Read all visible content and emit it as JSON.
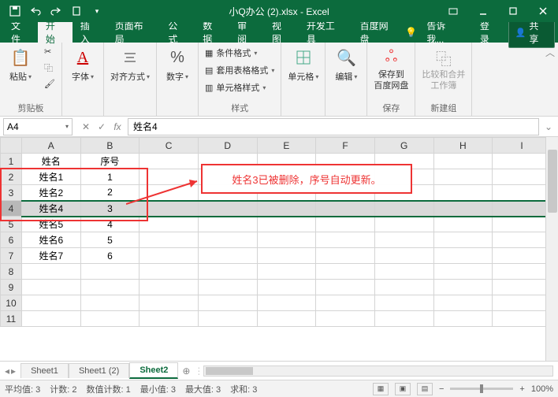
{
  "titlebar": {
    "title": "小Q办公 (2).xlsx - Excel"
  },
  "menu": {
    "file": "文件",
    "home": "开始",
    "insert": "插入",
    "layout": "页面布局",
    "formula": "公式",
    "data": "数据",
    "review": "审阅",
    "view": "视图",
    "dev": "开发工具",
    "baidu": "百度网盘",
    "tellme": "告诉我...",
    "login": "登录",
    "share": "共享"
  },
  "ribbon": {
    "paste": "粘贴",
    "clipboard": "剪贴板",
    "font": "字体",
    "align": "对齐方式",
    "number": "数字",
    "condfmt": "条件格式",
    "tablefmt": "套用表格格式",
    "cellfmt": "单元格样式",
    "styles": "样式",
    "cells": "单元格",
    "edit": "编辑",
    "baidu_save": "保存到",
    "baidu_line2": "百度网盘",
    "baidu_group": "保存",
    "compare": "比较和合并",
    "compare2": "工作簿",
    "newgroup": "新建组"
  },
  "fx": {
    "name": "A4",
    "formula": "姓名4"
  },
  "cols": [
    "A",
    "B",
    "C",
    "D",
    "E",
    "F",
    "G",
    "H",
    "I"
  ],
  "rows": [
    {
      "n": "1",
      "a": "姓名",
      "b": "序号"
    },
    {
      "n": "2",
      "a": "姓名1",
      "b": "1"
    },
    {
      "n": "3",
      "a": "姓名2",
      "b": "2"
    },
    {
      "n": "4",
      "a": "姓名4",
      "b": "3",
      "selected": true
    },
    {
      "n": "5",
      "a": "姓名5",
      "b": "4"
    },
    {
      "n": "6",
      "a": "姓名6",
      "b": "5"
    },
    {
      "n": "7",
      "a": "姓名7",
      "b": "6"
    },
    {
      "n": "8",
      "a": "",
      "b": ""
    },
    {
      "n": "9",
      "a": "",
      "b": ""
    },
    {
      "n": "10",
      "a": "",
      "b": ""
    },
    {
      "n": "11",
      "a": "",
      "b": ""
    }
  ],
  "annotation": "姓名3已被删除，序号自动更新。",
  "sheets": {
    "s1": "Sheet1",
    "s2": "Sheet1 (2)",
    "s3": "Sheet2"
  },
  "status": {
    "avg": "平均值: 3",
    "count": "计数: 2",
    "numcount": "数值计数: 1",
    "min": "最小值: 3",
    "max": "最大值: 3",
    "sum": "求和: 3",
    "zoom": "100%"
  }
}
